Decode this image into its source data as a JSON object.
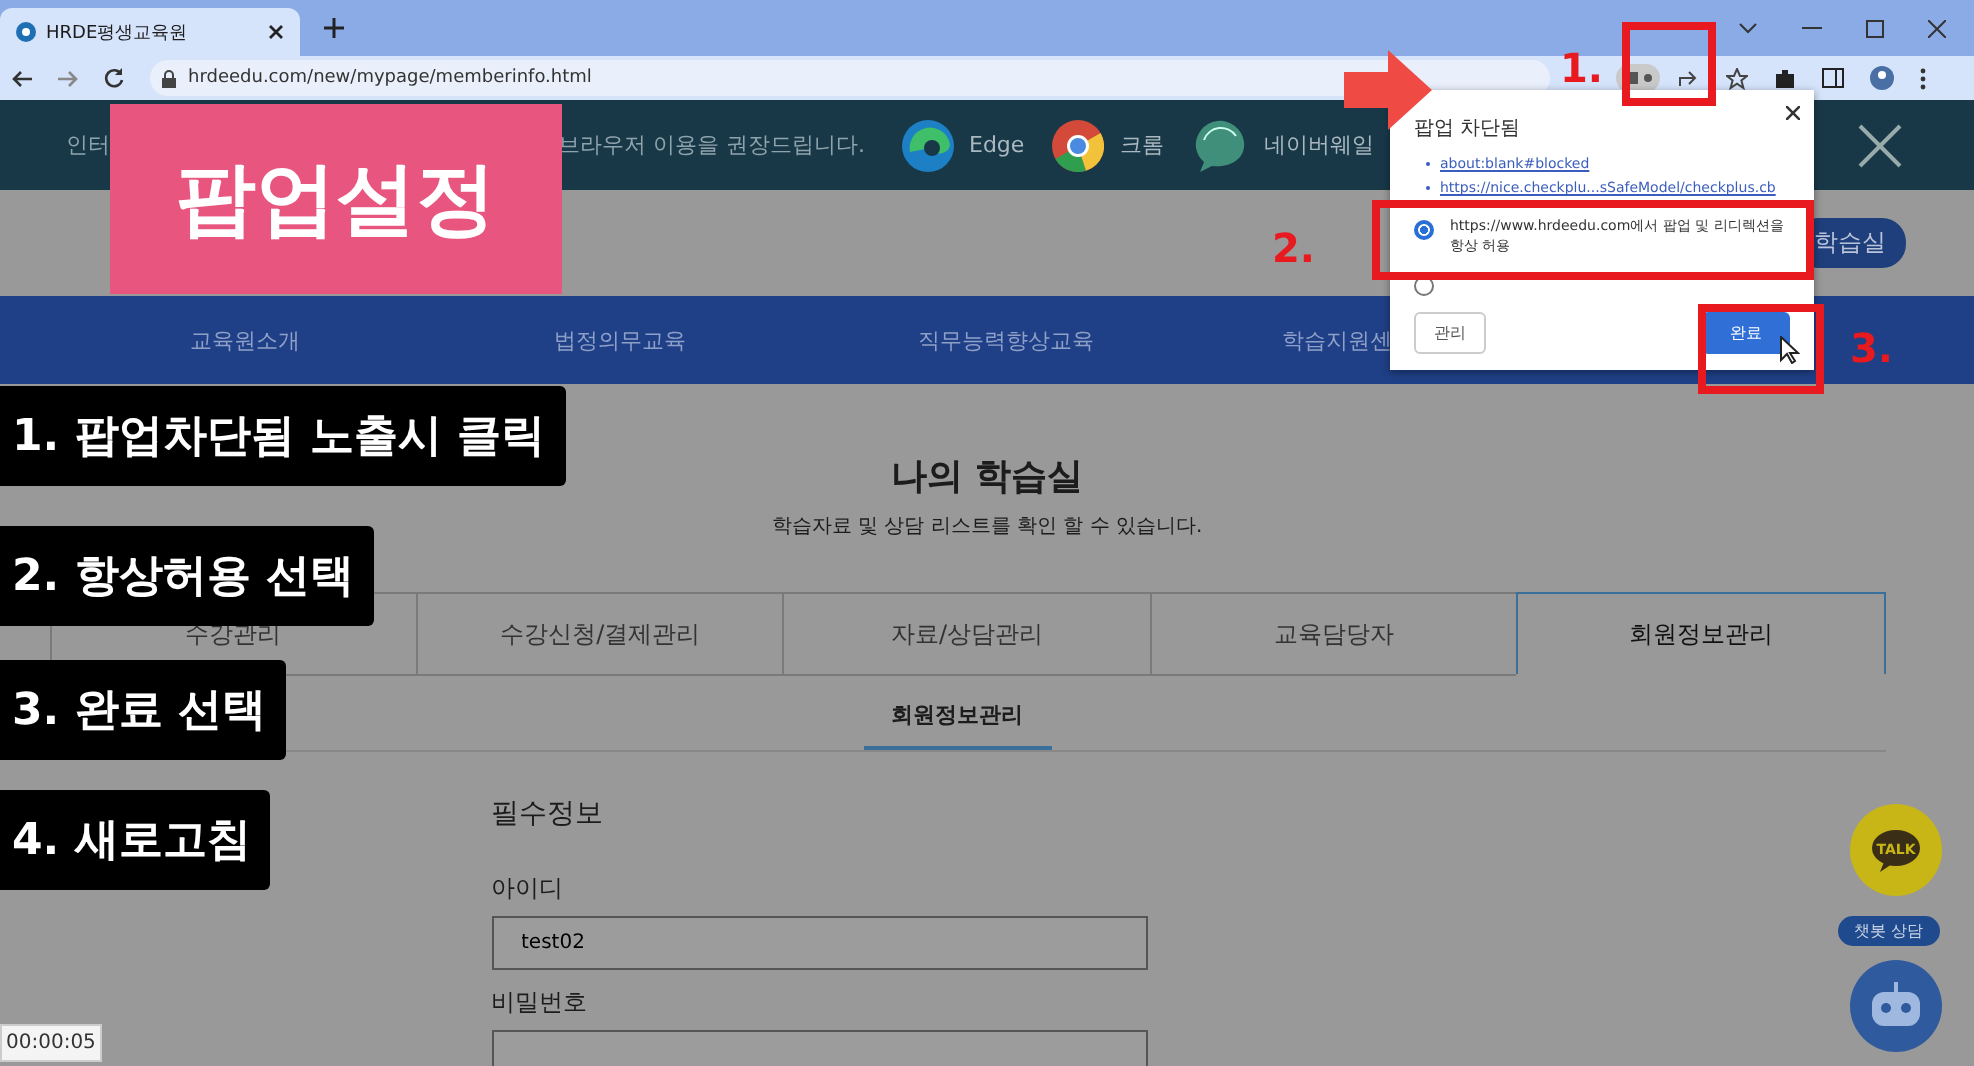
{
  "browser": {
    "tab_title": "HRDE평생교육원",
    "url": "hrdeedu.com/new/mypage/memberinfo.html"
  },
  "banner": {
    "text_start": "인터",
    "text_end": "브라우저 이용을 권장드립니다.",
    "browsers": [
      {
        "kind": "edge",
        "name": "Edge"
      },
      {
        "kind": "chrome",
        "name": "크롬"
      },
      {
        "kind": "whale",
        "name": "네이버웨일"
      }
    ]
  },
  "header": {
    "button": "학습실"
  },
  "nav": [
    "교육원소개",
    "법정의무교육",
    "직무능력향상교육",
    "학습지원센"
  ],
  "page": {
    "title": "나의 학습실",
    "subtitle": "학습자료 및 상담 리스트를 확인 할 수 있습니다.",
    "tabs": [
      {
        "label": "수강관리",
        "selected": false
      },
      {
        "label": "수강신청/결제관리",
        "selected": false
      },
      {
        "label": "자료/상담관리",
        "selected": false
      },
      {
        "label": "교육담당자",
        "selected": false
      },
      {
        "label": "회원정보관리",
        "selected": true
      }
    ],
    "subtabs": [
      {
        "label": "회원정보관리",
        "selected": true
      }
    ],
    "section_title": "필수정보",
    "fields": [
      {
        "label": "아이디",
        "value": "test02"
      },
      {
        "label": "비밀번호"
      }
    ]
  },
  "floating": {
    "kakao_label": "TALK",
    "chatbot_label": "챗봇 상담"
  },
  "popup": {
    "title": "팝업 차단됨",
    "links": [
      "about:blank#blocked",
      "https://nice.checkplu...sSafeModel/checkplus.cb"
    ],
    "options": [
      {
        "label": "https://www.hrdeedu.com에서 팝업 및 리디렉션을 항상 허용",
        "selected": true
      },
      {
        "selected": false
      }
    ],
    "buttons": [
      {
        "kind": "secondary",
        "label": "관리"
      },
      {
        "kind": "primary",
        "label": "완료"
      }
    ]
  },
  "overlay": {
    "badge": "팝업설정",
    "steps": [
      "1. 팝업차단됨 노출시 클릭",
      "2. 항상허용 선택",
      "3. 완료 선택",
      "4. 새로고침"
    ],
    "markers": [
      "1.",
      "2.",
      "3."
    ]
  },
  "timestamp": "00:00:05"
}
